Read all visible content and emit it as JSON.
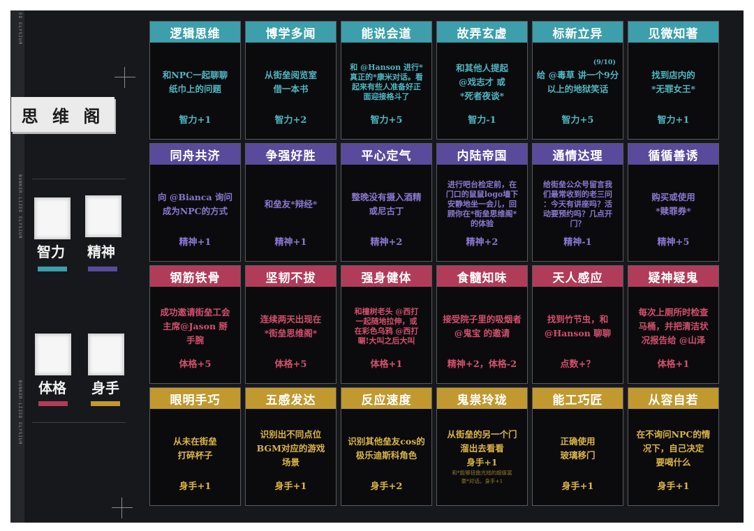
{
  "sidebar": {
    "title": "思 维 阁",
    "vertical_labels": [
      "ED ELYSIUM",
      "BUNKER-LIZED ELYSIUM",
      "BUNKER-LIZED ELYSIUM"
    ],
    "stats": [
      {
        "label": "智力",
        "color": "#3c9fab"
      },
      {
        "label": "精神",
        "color": "#5a4a9c"
      },
      {
        "label": "体格",
        "color": "#b13c5a"
      },
      {
        "label": "身手",
        "color": "#c1992f"
      }
    ]
  },
  "rows": [
    {
      "color": "#3c9fab",
      "text_color": "#4fb6c2",
      "cards": [
        {
          "title": "逻辑思维",
          "lines": [
            "和NPC一起聊聊",
            "纸巾上的问题"
          ],
          "effect": "智力+1"
        },
        {
          "title": "博学多闻",
          "lines": [
            "从街垒阅览室",
            "借一本书"
          ],
          "effect": "智力+2"
        },
        {
          "title": "能说会道",
          "lines": [
            "和 @Hanson 进行*",
            "真正的*康米对话。看",
            "起来有些人准备好正",
            "面迎接格斗了"
          ],
          "effect": "智力+5",
          "small": true
        },
        {
          "title": "故弄玄虚",
          "lines": [
            "和其他人提起",
            "@戏志才 或",
            "*死者夜谈*"
          ],
          "effect": "智力-1"
        },
        {
          "title": "标新立异",
          "lines": [
            "给 @毒草 讲一个9分",
            "以上的地狱笑话"
          ],
          "effect": "智力+5",
          "progress": "(9/10)"
        },
        {
          "title": "见微知著",
          "lines": [
            "找到店内的",
            "*无罪女王*"
          ],
          "effect": "智力+1"
        }
      ]
    },
    {
      "color": "#5a4a9c",
      "text_color": "#8a78d0",
      "cards": [
        {
          "title": "同舟共济",
          "lines": [
            "向 @Bianca 询问",
            "成为NPC的方式"
          ],
          "effect": "精神+1"
        },
        {
          "title": "争强好胜",
          "lines": [
            "和垒友*辩经*"
          ],
          "effect": "精神+1"
        },
        {
          "title": "平心定气",
          "lines": [
            "整晚没有摄入酒精",
            "或尼古丁"
          ],
          "effect": "精神+2"
        },
        {
          "title": "内陆帝国",
          "lines": [
            "进行吧台检定前，在",
            "门口的鼠鼠logo墙下",
            "安静地坐一会儿，回",
            "顾你在*街垒思维阁*",
            "的体验"
          ],
          "effect": "精神+2",
          "small": true
        },
        {
          "title": "通情达理",
          "lines": [
            "给街垒公众号留言我",
            "们最常收到的老三问",
            "：今天有讲座吗？活",
            "动要预约吗？几点开",
            "门？"
          ],
          "effect": "精神-1",
          "small": true
        },
        {
          "title": "循循善诱",
          "lines": [
            "购买或使用",
            "*赎罪券*"
          ],
          "effect": "精神+5"
        }
      ]
    },
    {
      "color": "#b13c5a",
      "text_color": "#d44f6e",
      "cards": [
        {
          "title": "钢筋铁骨",
          "lines": [
            "成功邀请街垒工会",
            "主席@Jason 掰",
            "手腕"
          ],
          "effect": "体格+5"
        },
        {
          "title": "坚韧不拔",
          "lines": [
            "连续两天出现在",
            "*街垒思维阁*"
          ],
          "effect": "体格+5"
        },
        {
          "title": "强身健体",
          "lines": [
            "和橦树老头 @西打",
            "一起随地拉伸，或",
            "在彩色乌鸦 @西打",
            "唰!大叫之后大叫"
          ],
          "effect": "体格+1",
          "small": true
        },
        {
          "title": "食髓知味",
          "lines": [
            "接受院子里的吸烟者",
            "@鬼宝 的邀请"
          ],
          "effect": "精神+2，体格-2"
        },
        {
          "title": "天人感应",
          "lines": [
            "找到竹节虫，和",
            "@Hanson 聊聊"
          ],
          "effect": "点数+？"
        },
        {
          "title": "疑神疑鬼",
          "lines": [
            "每次上厕所时检查",
            "马桶，并把清洁状",
            "况报告给 @山泽"
          ],
          "effect": "体格+1"
        }
      ]
    },
    {
      "color": "#c1992f",
      "text_color": "#dcb546",
      "cards": [
        {
          "title": "眼明手巧",
          "lines": [
            "从未在街垒",
            "打碎杯子"
          ],
          "effect": "身手+1"
        },
        {
          "title": "五感发达",
          "lines": [
            "识别出不同点位",
            "BGM对应的游戏",
            "场景"
          ],
          "effect": "身手+1"
        },
        {
          "title": "反应速度",
          "lines": [
            "识别其他垒友cos的",
            "极乐迪斯科角色"
          ],
          "effect": "身手+2"
        },
        {
          "title": "鬼祟玲珑",
          "lines": [
            "从街垒的另一个门",
            "溜出去看看",
            "身手+1"
          ],
          "effect": "",
          "note": [
            "和*能够扭曲光线的超级富",
            "豪*对话。身手+1"
          ]
        },
        {
          "title": "能工巧匠",
          "lines": [
            "正确使用",
            "玻璃移门"
          ],
          "effect": "身手+1"
        },
        {
          "title": "从容自若",
          "lines": [
            "在不询问NPC的情",
            "况下，自己决定",
            "要喝什么"
          ],
          "effect": "身手+1"
        }
      ]
    }
  ]
}
